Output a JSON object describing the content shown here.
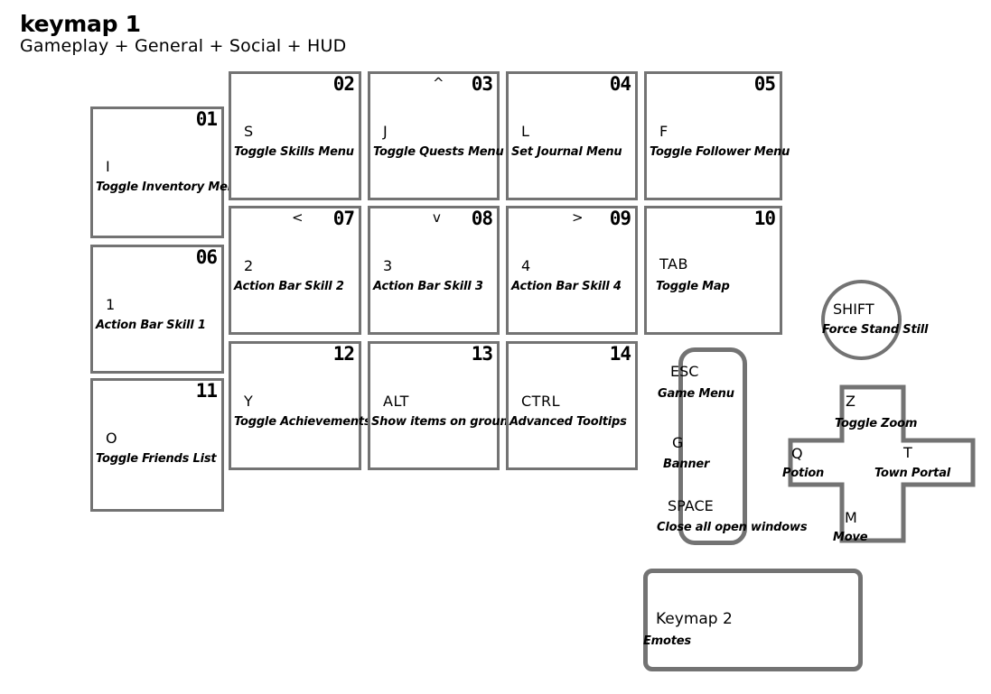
{
  "header": {
    "title": "keymap 1",
    "subtitle": "Gameplay + General + Social + HUD"
  },
  "colors": {
    "border": "#737373",
    "background": "#ffffff",
    "text": "#000000"
  },
  "keys": [
    {
      "num": "01",
      "arrow": "",
      "cap": "I",
      "action": "Toggle Inventory Menu"
    },
    {
      "num": "02",
      "arrow": "",
      "cap": "S",
      "action": "Toggle Skills Menu"
    },
    {
      "num": "03",
      "arrow": "^",
      "cap": "J",
      "action": "Toggle Quests Menu"
    },
    {
      "num": "04",
      "arrow": "",
      "cap": "L",
      "action": "Set Journal Menu"
    },
    {
      "num": "05",
      "arrow": "",
      "cap": "F",
      "action": "Toggle Follower Menu"
    },
    {
      "num": "06",
      "arrow": "",
      "cap": "1",
      "action": "Action Bar Skill 1"
    },
    {
      "num": "07",
      "arrow": "<",
      "cap": "2",
      "action": "Action Bar Skill 2"
    },
    {
      "num": "08",
      "arrow": "v",
      "cap": "3",
      "action": "Action Bar Skill 3"
    },
    {
      "num": "09",
      "arrow": ">",
      "cap": "4",
      "action": "Action Bar Skill 4"
    },
    {
      "num": "10",
      "arrow": "",
      "cap": "TAB",
      "action": "Toggle Map"
    },
    {
      "num": "11",
      "arrow": "",
      "cap": "O",
      "action": "Toggle Friends List"
    },
    {
      "num": "12",
      "arrow": "",
      "cap": "Y",
      "action": "Toggle Achievements"
    },
    {
      "num": "13",
      "arrow": "",
      "cap": "ALT",
      "action": "Show items on ground"
    },
    {
      "num": "14",
      "arrow": "",
      "cap": "CTRL",
      "action": "Advanced Tooltips"
    }
  ],
  "capsule": {
    "entries": [
      {
        "cap": "ESC",
        "action": "Game Menu"
      },
      {
        "cap": "G",
        "action": "Banner"
      },
      {
        "cap": "SPACE",
        "action": "Close all open windows"
      }
    ]
  },
  "circle": {
    "cap": "SHIFT",
    "action": "Force Stand Still"
  },
  "cross": {
    "top": {
      "cap": "Z",
      "action": "Toggle Zoom"
    },
    "left": {
      "cap": "Q",
      "action": "Potion"
    },
    "right": {
      "cap": "T",
      "action": "Town Portal"
    },
    "bottom": {
      "cap": "M",
      "action": "Move"
    }
  },
  "keymap2": {
    "cap": "Keymap 2",
    "action": "Emotes"
  }
}
